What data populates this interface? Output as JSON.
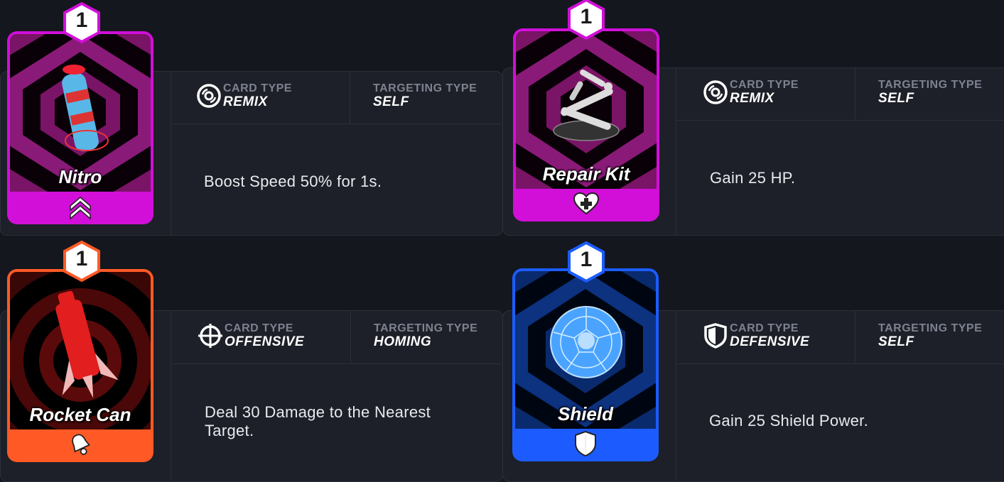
{
  "labels": {
    "card_type": "CARD TYPE",
    "targeting_type": "TARGETING TYPE"
  },
  "cards": [
    {
      "name": "Nitro",
      "cost": "1",
      "card_type": "REMIX",
      "targeting": "SELF",
      "description": "Boost Speed 50% for 1s.",
      "color": "#d10fd8",
      "type_icon": "remix-disc-icon",
      "foot_icon": "speed-chevrons-icon"
    },
    {
      "name": "Repair Kit",
      "cost": "1",
      "card_type": "REMIX",
      "targeting": "SELF",
      "description": "Gain 25 HP.",
      "color": "#d10fd8",
      "type_icon": "remix-disc-icon",
      "foot_icon": "heart-plus-icon"
    },
    {
      "name": "Rocket Can",
      "cost": "1",
      "card_type": "OFFENSIVE",
      "targeting": "HOMING",
      "description": "Deal 30 Damage to the Nearest Target.",
      "color": "#ff5a26",
      "type_icon": "crosshair-icon",
      "foot_icon": "bell-icon"
    },
    {
      "name": "Shield",
      "cost": "1",
      "card_type": "DEFENSIVE",
      "targeting": "SELF",
      "description": "Gain 25 Shield Power.",
      "color": "#1c5cff",
      "type_icon": "shield-icon",
      "foot_icon": "shield-icon"
    }
  ]
}
